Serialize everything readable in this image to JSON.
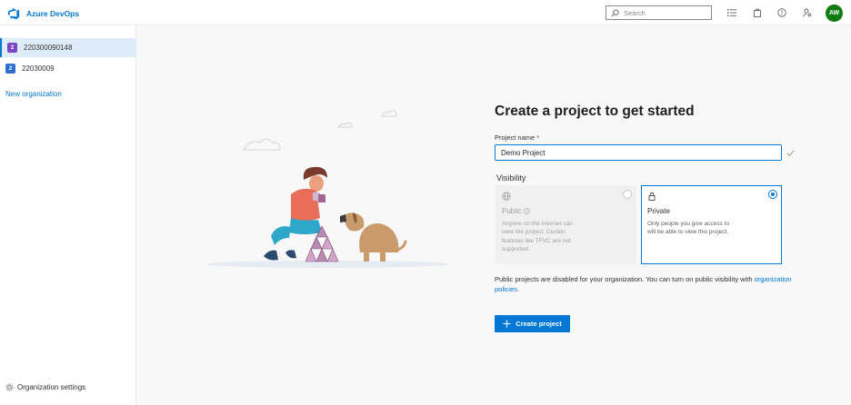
{
  "header": {
    "brand_name": "Azure DevOps",
    "search_placeholder": "Search",
    "icons": [
      "settings-list-icon",
      "marketplace-bag-icon",
      "help-icon",
      "user-settings-icon"
    ],
    "avatar_initials": "AW"
  },
  "sidebar": {
    "organizations": [
      {
        "badge": "2",
        "name": "220300090148",
        "badge_color": "#7a44c7",
        "selected": true
      },
      {
        "badge": "2",
        "name": "22030009",
        "badge_color": "#2f6fcf",
        "selected": false
      }
    ],
    "new_org_label": "New organization",
    "settings_label": "Organization settings"
  },
  "form": {
    "title": "Create a project to get started",
    "name_label": "Project name",
    "name_required_marker": "*",
    "name_value": "Demo Project",
    "visibility_label": "Visibility",
    "public": {
      "title": "Public",
      "description": "Anyone on the internet can view the project. Certain features like TFVC are not supported.",
      "selected": false,
      "disabled": true
    },
    "private": {
      "title": "Private",
      "description": "Only people you give access to will be able to view this project.",
      "selected": true
    },
    "notice_text": "Public projects are disabled for your organization. You can turn on public visibility with",
    "notice_link": "organization policies",
    "notice_end": ".",
    "create_button": "Create project"
  },
  "colors": {
    "accent": "#0078d4",
    "avatar": "#107c10",
    "background": "#f8f8f8"
  }
}
